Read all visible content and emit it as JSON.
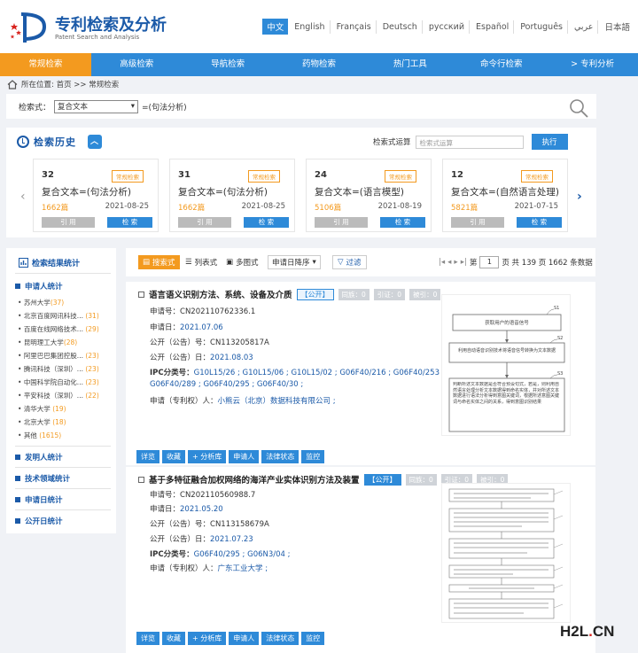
{
  "header": {
    "brand": "专利检索及分析",
    "brand_sub": "Patent Search and Analysis",
    "languages": [
      "中文",
      "English",
      "Français",
      "Deutsch",
      "русский",
      "Español",
      "Português",
      "عربي",
      "日本語"
    ]
  },
  "nav": [
    "常规检索",
    "高级检索",
    "导航检索",
    "药物检索",
    "热门工具",
    "命令行检索",
    "> 专利分析"
  ],
  "breadcrumb": "所在位置: 首页 >> 常规检索",
  "search": {
    "label": "检索式：",
    "mode": "复合文本",
    "hint": "=(句法分析)"
  },
  "history": {
    "title": "检索历史",
    "op_label": "检索式运算",
    "op_placeholder": "检索式运算",
    "exec_label": "执行",
    "cards": [
      {
        "num": "32",
        "tag": "常规检索",
        "text": "复合文本=(句法分析)",
        "count": "1662篇",
        "date": "2021-08-25",
        "ref": "引 用",
        "search": "检 索"
      },
      {
        "num": "31",
        "tag": "常规检索",
        "text": "复合文本=(句法分析)",
        "count": "1662篇",
        "date": "2021-08-25",
        "ref": "引 用",
        "search": "检 索"
      },
      {
        "num": "24",
        "tag": "常规检索",
        "text": "复合文本=(语言模型)",
        "count": "5106篇",
        "date": "2021-08-19",
        "ref": "引 用",
        "search": "检 索"
      },
      {
        "num": "12",
        "tag": "常规检索",
        "text": "复合文本=(自然语言处理)",
        "count": "5821篇",
        "date": "2021-07-15",
        "ref": "引 用",
        "search": "检 索"
      }
    ]
  },
  "sidebar": {
    "title": "检索结果统计",
    "applicant_section": "申请人统计",
    "applicants": [
      {
        "name": "苏州大学",
        "count": "(37)"
      },
      {
        "name": "北京百度网讯科技...",
        "count": "(31)"
      },
      {
        "name": "百度在线网络技术...",
        "count": "(29)"
      },
      {
        "name": "昆明理工大学",
        "count": "(28)"
      },
      {
        "name": "阿里巴巴集团控股...",
        "count": "(23)"
      },
      {
        "name": "腾讯科技（深圳）...",
        "count": "(23)"
      },
      {
        "name": "中国科学院自动化...",
        "count": "(23)"
      },
      {
        "name": "平安科技（深圳）...",
        "count": "(22)"
      },
      {
        "name": "清华大学",
        "count": "(19)"
      },
      {
        "name": "北京大学",
        "count": "(18)"
      },
      {
        "name": "其他",
        "count": "(1615)"
      }
    ],
    "sections": [
      "发明人统计",
      "技术领域统计",
      "申请日统计",
      "公开日统计"
    ]
  },
  "toolbar": {
    "view_search": "搜索式",
    "view_list": "列表式",
    "view_image": "多图式",
    "sort": "申请日降序",
    "filter": "过滤",
    "page_label": "第",
    "page_value": "1",
    "page_info": "页 共 139 页 1662 条数据"
  },
  "results": [
    {
      "title": "语言语义识别方法、系统、设备及介质",
      "status": "【公开】",
      "cited": "同族：0",
      "citing": "引证：0",
      "cited_by": "被引：0",
      "app_no_label": "申请号：",
      "app_no": "CN202110762336.1",
      "app_date_label": "申请日：",
      "app_date": "2021.07.06",
      "pub_no_label": "公开（公告）号：",
      "pub_no": "CN113205817A",
      "pub_date_label": "公开（公告）日：",
      "pub_date": "2021.08.03",
      "ipc_label": "IPC分类号：",
      "ipc_line1": "G10L15/26 ; G10L15/06 ; G10L15/02 ; G06F40/216 ; G06F40/253 ;",
      "ipc_line2": "G06F40/289 ; G06F40/295 ; G06F40/30 ;",
      "applicant_label": "申请（专利权）人：",
      "applicant": "小熊云（北京）数据科技有限公司 ;",
      "figure": {
        "steps": [
          "获取用户的语音信号",
          "利用自动语音识别技术将语音信号转换为文本数据",
          "判断所述文本数据是否符合预设句式，若是，则利用自然语言处理分析文本数据得到命名实体，并对所述文本数据进行语法分析得到意图关键词，根据所述意图关键词与命名实体之间的关系，得到意图识别结果"
        ],
        "labels": [
          "S1",
          "S2",
          "S3"
        ]
      },
      "actions": [
        "详览",
        "收藏",
        "+ 分析库",
        "申请人",
        "法律状态",
        "监控"
      ]
    },
    {
      "title": "基于多特征融合加权网络的海洋产业实体识别方法及装置",
      "status": "【公开】",
      "cited": "同族：0",
      "citing": "引证：0",
      "cited_by": "被引：0",
      "app_no_label": "申请号：",
      "app_no": "CN202110560988.7",
      "app_date_label": "申请日：",
      "app_date": "2021.05.20",
      "pub_no_label": "公开（公告）号：",
      "pub_no": "CN113158679A",
      "pub_date_label": "公开（公告）日：",
      "pub_date": "2021.07.23",
      "ipc_label": "IPC分类号：",
      "ipc_line1": "G06F40/295 ; G06N3/04 ;",
      "applicant_label": "申请（专利权）人：",
      "applicant": "广东工业大学 ;",
      "actions": [
        "详览",
        "收藏",
        "+ 分析库",
        "申请人",
        "法律状态",
        "监控"
      ]
    }
  ],
  "watermark": {
    "main": "H2L",
    "dot": ".",
    "tld": "CN"
  }
}
